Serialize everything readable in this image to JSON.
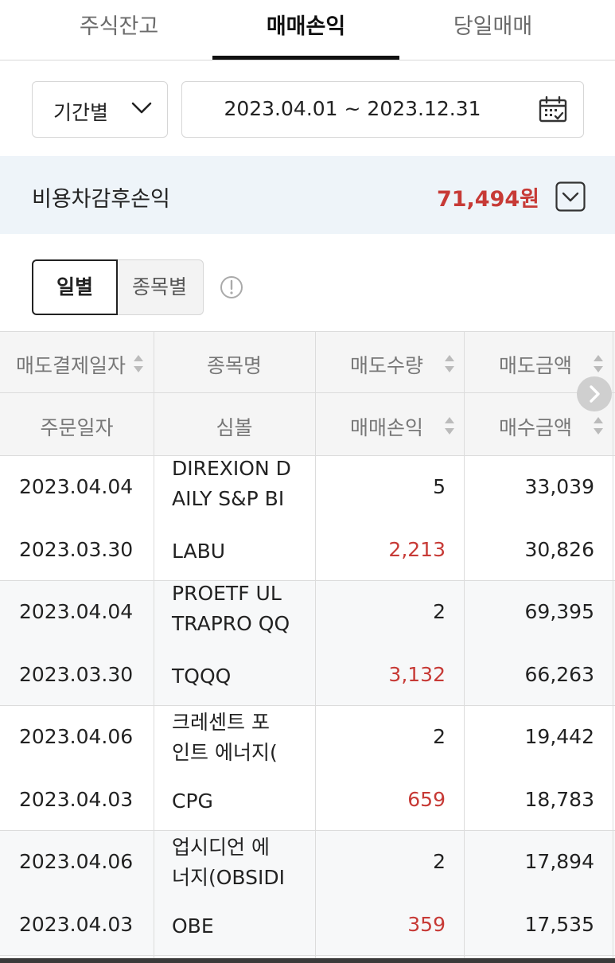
{
  "tabs": [
    {
      "label": "주식잔고"
    },
    {
      "label": "매매손익"
    },
    {
      "label": "당일매매"
    }
  ],
  "filter": {
    "period_label": "기간별",
    "date_range": "2023.04.01 ~ 2023.12.31"
  },
  "summary": {
    "label": "비용차감후손익",
    "amount": "71,494원",
    "amount_color": "#c73a36"
  },
  "view_toggle": {
    "daily": "일별",
    "by_item": "종목별"
  },
  "table": {
    "headers_top": [
      "매도결제일자",
      "종목명",
      "매도수량",
      "매도금액"
    ],
    "headers_bottom": [
      "주문일자",
      "심볼",
      "매매손익",
      "매수금액"
    ],
    "rows": [
      {
        "sell_settle_date": "2023.04.04",
        "name_line1": "DIREXION D",
        "name_line2": "AILY S&P BI",
        "sell_qty": "5",
        "sell_amount": "33,039",
        "order_date": "2023.03.30",
        "symbol": "LABU",
        "pnl": "2,213",
        "buy_amount": "30,826"
      },
      {
        "sell_settle_date": "2023.04.04",
        "name_line1": "PROETF UL",
        "name_line2": "TRAPRO QQ",
        "sell_qty": "2",
        "sell_amount": "69,395",
        "order_date": "2023.03.30",
        "symbol": "TQQQ",
        "pnl": "3,132",
        "buy_amount": "66,263"
      },
      {
        "sell_settle_date": "2023.04.06",
        "name_line1": "크레센트 포",
        "name_line2": "인트 에너지(",
        "sell_qty": "2",
        "sell_amount": "19,442",
        "order_date": "2023.04.03",
        "symbol": "CPG",
        "pnl": "659",
        "buy_amount": "18,783"
      },
      {
        "sell_settle_date": "2023.04.06",
        "name_line1": "업시디언 에",
        "name_line2": "너지(OBSIDI",
        "sell_qty": "2",
        "sell_amount": "17,894",
        "order_date": "2023.04.03",
        "symbol": "OBE",
        "pnl": "359",
        "buy_amount": "17,535"
      }
    ]
  }
}
